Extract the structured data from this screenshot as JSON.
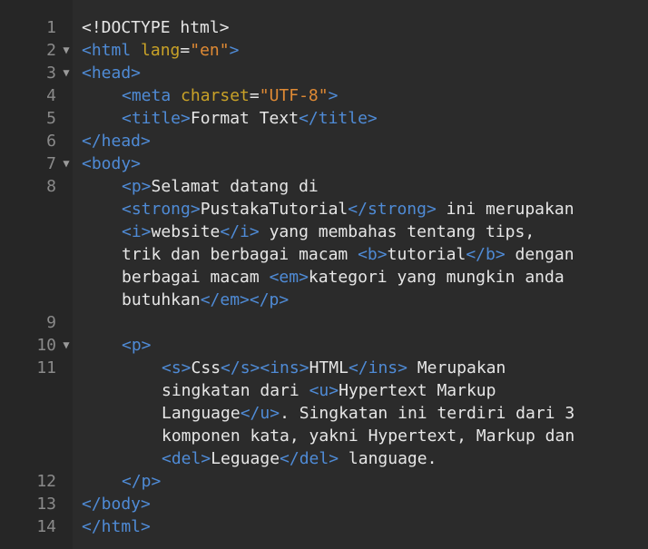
{
  "editor": {
    "lines": [
      {
        "num": "1",
        "fold": "",
        "indent": 0,
        "segments": [
          {
            "t": "txt",
            "v": "<!DOCTYPE html>"
          }
        ]
      },
      {
        "num": "2",
        "fold": "▼",
        "indent": 0,
        "segments": [
          {
            "t": "tag",
            "v": "<html "
          },
          {
            "t": "attr",
            "v": "lang"
          },
          {
            "t": "txt",
            "v": "="
          },
          {
            "t": "str",
            "v": "\"en\""
          },
          {
            "t": "tag",
            "v": ">"
          }
        ]
      },
      {
        "num": "3",
        "fold": "▼",
        "indent": 0,
        "segments": [
          {
            "t": "tag",
            "v": "<head>"
          }
        ]
      },
      {
        "num": "4",
        "fold": "",
        "indent": 4,
        "segments": [
          {
            "t": "tag",
            "v": "<meta "
          },
          {
            "t": "attr",
            "v": "charset"
          },
          {
            "t": "txt",
            "v": "="
          },
          {
            "t": "str",
            "v": "\"UTF-8\""
          },
          {
            "t": "tag",
            "v": ">"
          }
        ]
      },
      {
        "num": "5",
        "fold": "",
        "indent": 4,
        "segments": [
          {
            "t": "tag",
            "v": "<title>"
          },
          {
            "t": "txt",
            "v": "Format Text"
          },
          {
            "t": "tag",
            "v": "</title>"
          }
        ]
      },
      {
        "num": "6",
        "fold": "",
        "indent": 0,
        "segments": [
          {
            "t": "tag",
            "v": "</head>"
          }
        ]
      },
      {
        "num": "7",
        "fold": "▼",
        "indent": 0,
        "segments": [
          {
            "t": "tag",
            "v": "<body>"
          }
        ]
      },
      {
        "num": "8",
        "fold": "",
        "indent": 4,
        "segments": [
          {
            "t": "tag",
            "v": "<p>"
          },
          {
            "t": "txt",
            "v": "Selamat datang di"
          }
        ]
      },
      {
        "num": "",
        "fold": "",
        "indent": 4,
        "segments": [
          {
            "t": "tag",
            "v": "<strong>"
          },
          {
            "t": "txt",
            "v": "PustakaTutorial"
          },
          {
            "t": "tag",
            "v": "</strong>"
          },
          {
            "t": "txt",
            "v": " ini merupakan"
          }
        ]
      },
      {
        "num": "",
        "fold": "",
        "indent": 4,
        "segments": [
          {
            "t": "tag",
            "v": "<i>"
          },
          {
            "t": "txt",
            "v": "website"
          },
          {
            "t": "tag",
            "v": "</i>"
          },
          {
            "t": "txt",
            "v": " yang membahas tentang tips,"
          }
        ]
      },
      {
        "num": "",
        "fold": "",
        "indent": 4,
        "segments": [
          {
            "t": "txt",
            "v": "trik dan berbagai macam "
          },
          {
            "t": "tag",
            "v": "<b>"
          },
          {
            "t": "txt",
            "v": "tutorial"
          },
          {
            "t": "tag",
            "v": "</b>"
          },
          {
            "t": "txt",
            "v": " dengan"
          }
        ]
      },
      {
        "num": "",
        "fold": "",
        "indent": 4,
        "segments": [
          {
            "t": "txt",
            "v": "berbagai macam "
          },
          {
            "t": "tag",
            "v": "<em>"
          },
          {
            "t": "txt",
            "v": "kategori yang mungkin anda"
          }
        ]
      },
      {
        "num": "",
        "fold": "",
        "indent": 4,
        "segments": [
          {
            "t": "txt",
            "v": "butuhkan"
          },
          {
            "t": "tag",
            "v": "</em></p>"
          }
        ]
      },
      {
        "num": "9",
        "fold": "",
        "indent": 0,
        "segments": []
      },
      {
        "num": "10",
        "fold": "▼",
        "indent": 4,
        "segments": [
          {
            "t": "tag",
            "v": "<p>"
          }
        ]
      },
      {
        "num": "11",
        "fold": "",
        "indent": 8,
        "segments": [
          {
            "t": "tag",
            "v": "<s>"
          },
          {
            "t": "txt",
            "v": "Css"
          },
          {
            "t": "tag",
            "v": "</s><ins>"
          },
          {
            "t": "txt",
            "v": "HTML"
          },
          {
            "t": "tag",
            "v": "</ins>"
          },
          {
            "t": "txt",
            "v": " Merupakan"
          }
        ]
      },
      {
        "num": "",
        "fold": "",
        "indent": 8,
        "segments": [
          {
            "t": "txt",
            "v": "singkatan dari "
          },
          {
            "t": "tag",
            "v": "<u>"
          },
          {
            "t": "txt",
            "v": "Hypertext Markup"
          }
        ]
      },
      {
        "num": "",
        "fold": "",
        "indent": 8,
        "segments": [
          {
            "t": "txt",
            "v": "Language"
          },
          {
            "t": "tag",
            "v": "</u>"
          },
          {
            "t": "txt",
            "v": ". Singkatan ini terdiri dari 3"
          }
        ]
      },
      {
        "num": "",
        "fold": "",
        "indent": 8,
        "segments": [
          {
            "t": "txt",
            "v": "komponen kata, yakni Hypertext, Markup dan"
          }
        ]
      },
      {
        "num": "",
        "fold": "",
        "indent": 8,
        "segments": [
          {
            "t": "tag",
            "v": "<del>"
          },
          {
            "t": "txt",
            "v": "Leguage"
          },
          {
            "t": "tag",
            "v": "</del>"
          },
          {
            "t": "txt",
            "v": " language."
          }
        ]
      },
      {
        "num": "12",
        "fold": "",
        "indent": 4,
        "segments": [
          {
            "t": "tag",
            "v": "</p>"
          }
        ]
      },
      {
        "num": "13",
        "fold": "",
        "indent": 0,
        "segments": [
          {
            "t": "tag",
            "v": "</body>"
          }
        ]
      },
      {
        "num": "14",
        "fold": "",
        "indent": 0,
        "segments": [
          {
            "t": "tag",
            "v": "</html>"
          }
        ]
      }
    ]
  }
}
